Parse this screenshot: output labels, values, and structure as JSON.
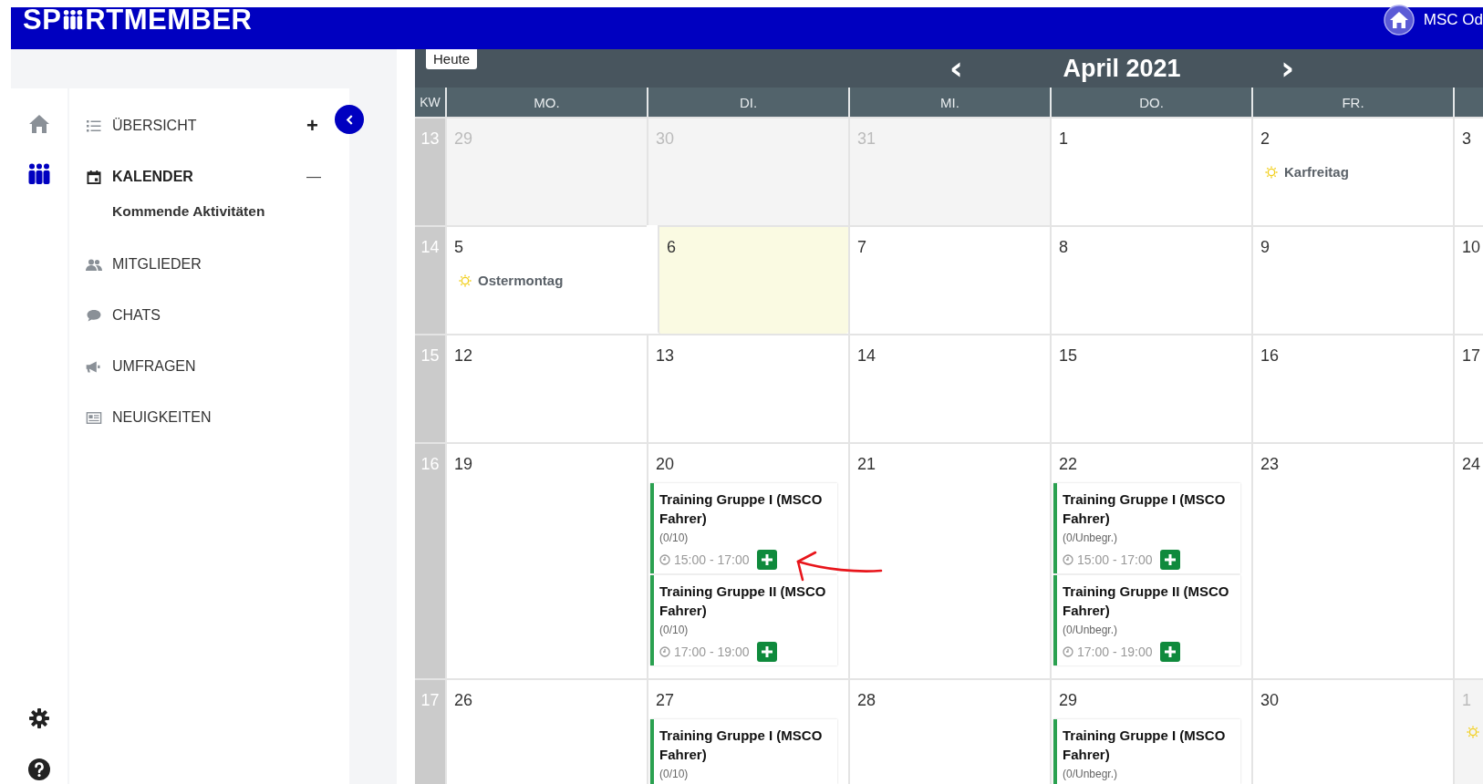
{
  "header": {
    "logo_before": "SP",
    "logo_after": "RTMEMBER",
    "club": "MSC Od"
  },
  "rail": [
    {
      "kind": "home",
      "selected": false
    },
    {
      "kind": "members",
      "selected": true
    }
  ],
  "rail_bottom": [
    {
      "kind": "settings"
    },
    {
      "kind": "help"
    }
  ],
  "nav": [
    {
      "kind": "list",
      "label": "ÜBERSICHT",
      "selected": false,
      "expanded": false,
      "toggle": "+"
    },
    {
      "kind": "calendar",
      "label": "KALENDER",
      "selected": true,
      "expanded": true,
      "toggle": "—",
      "children": [
        {
          "label": "Kommende Aktivitäten"
        }
      ]
    },
    {
      "kind": "members",
      "label": "MITGLIEDER",
      "selected": false
    },
    {
      "kind": "chat",
      "label": "CHATS",
      "selected": false
    },
    {
      "kind": "megaphone",
      "label": "UMFRAGEN",
      "selected": false
    },
    {
      "kind": "news",
      "label": "NEUIGKEITEN",
      "selected": false
    }
  ],
  "calendar": {
    "today_button": "Heute",
    "month": "April 2021",
    "prev": "‹",
    "next": "›",
    "kw_label": "KW",
    "weekdays": [
      "MO.",
      "DI.",
      "MI.",
      "DO.",
      "FR."
    ],
    "weeks": [
      {
        "kw": "13",
        "days": [
          {
            "date": "29",
            "outside": true,
            "today": false
          },
          {
            "date": "30",
            "outside": true,
            "today": false
          },
          {
            "date": "31",
            "outside": true,
            "today": false
          },
          {
            "date": "1",
            "outside": false,
            "today": false
          },
          {
            "date": "2",
            "outside": false,
            "today": false,
            "holiday": "Karfreitag"
          },
          {
            "date": "3",
            "outside": false,
            "today": false
          }
        ]
      },
      {
        "kw": "14",
        "days": [
          {
            "date": "5",
            "outside": false,
            "today": false,
            "holiday": "Ostermontag"
          },
          {
            "date": "6",
            "outside": false,
            "today": true
          },
          {
            "date": "7",
            "outside": false,
            "today": false
          },
          {
            "date": "8",
            "outside": false,
            "today": false
          },
          {
            "date": "9",
            "outside": false,
            "today": false
          },
          {
            "date": "10",
            "outside": false,
            "today": false
          }
        ]
      },
      {
        "kw": "15",
        "days": [
          {
            "date": "12",
            "outside": false,
            "today": false
          },
          {
            "date": "13",
            "outside": false,
            "today": false
          },
          {
            "date": "14",
            "outside": false,
            "today": false
          },
          {
            "date": "15",
            "outside": false,
            "today": false
          },
          {
            "date": "16",
            "outside": false,
            "today": false
          },
          {
            "date": "17",
            "outside": false,
            "today": false
          }
        ]
      },
      {
        "kw": "16",
        "days": [
          {
            "date": "19",
            "outside": false,
            "today": false
          },
          {
            "date": "20",
            "outside": false,
            "today": false,
            "events": [
              {
                "title": "Training Gruppe I (MSCO Fahrer)",
                "capacity": "(0/10)",
                "time": "15:00 - 17:00"
              },
              {
                "title": "Training Gruppe II (MSCO Fahrer)",
                "capacity": "(0/10)",
                "time": "17:00 - 19:00"
              }
            ]
          },
          {
            "date": "21",
            "outside": false,
            "today": false
          },
          {
            "date": "22",
            "outside": false,
            "today": false,
            "events": [
              {
                "title": "Training Gruppe I (MSCO Fahrer)",
                "capacity": "(0/Unbegr.)",
                "time": "15:00 - 17:00"
              },
              {
                "title": "Training Gruppe II (MSCO Fahrer)",
                "capacity": "(0/Unbegr.)",
                "time": "17:00 - 19:00"
              }
            ]
          },
          {
            "date": "23",
            "outside": false,
            "today": false
          },
          {
            "date": "24",
            "outside": false,
            "today": false
          }
        ]
      },
      {
        "kw": "17",
        "days": [
          {
            "date": "26",
            "outside": false,
            "today": false
          },
          {
            "date": "27",
            "outside": false,
            "today": false,
            "events": [
              {
                "title": "Training Gruppe I (MSCO Fahrer)",
                "capacity": "(0/10)"
              }
            ]
          },
          {
            "date": "28",
            "outside": false,
            "today": false
          },
          {
            "date": "29",
            "outside": false,
            "today": false,
            "events": [
              {
                "title": "Training Gruppe I (MSCO Fahrer)",
                "capacity": "(0/Unbegr.)"
              }
            ]
          },
          {
            "date": "30",
            "outside": false,
            "today": false
          },
          {
            "date": "1",
            "outside": true,
            "today": false,
            "holiday_icon": true
          }
        ]
      }
    ]
  }
}
